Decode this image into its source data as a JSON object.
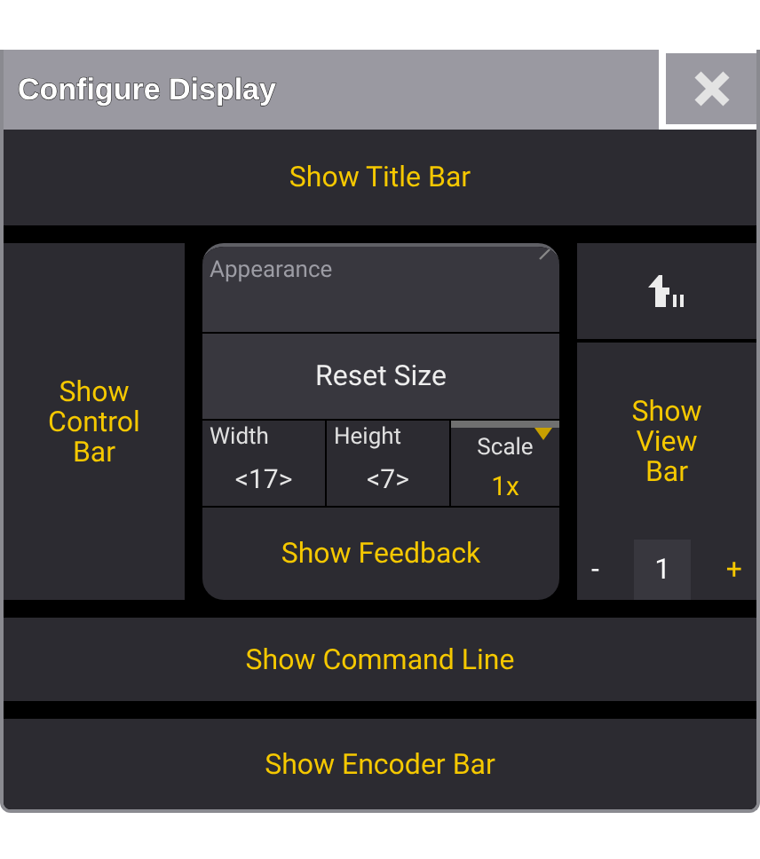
{
  "window": {
    "title": "Configure Display"
  },
  "show_title_bar": "Show Title Bar",
  "show_control_bar": "Show Control Bar",
  "appearance": {
    "label": "Appearance",
    "reset": "Reset Size",
    "fields": [
      {
        "kind": "value",
        "label": "Width",
        "value": "<17>"
      },
      {
        "kind": "value",
        "label": "Height",
        "value": "<7>"
      },
      {
        "kind": "dropdown",
        "label": "Scale",
        "value": "1x"
      }
    ],
    "feedback": "Show Feedback"
  },
  "view_bar": {
    "label": "Show View Bar",
    "minus": "-",
    "value": "1",
    "plus": "+"
  },
  "show_command_line": "Show Command Line",
  "show_encoder_bar": "Show Encoder Bar"
}
